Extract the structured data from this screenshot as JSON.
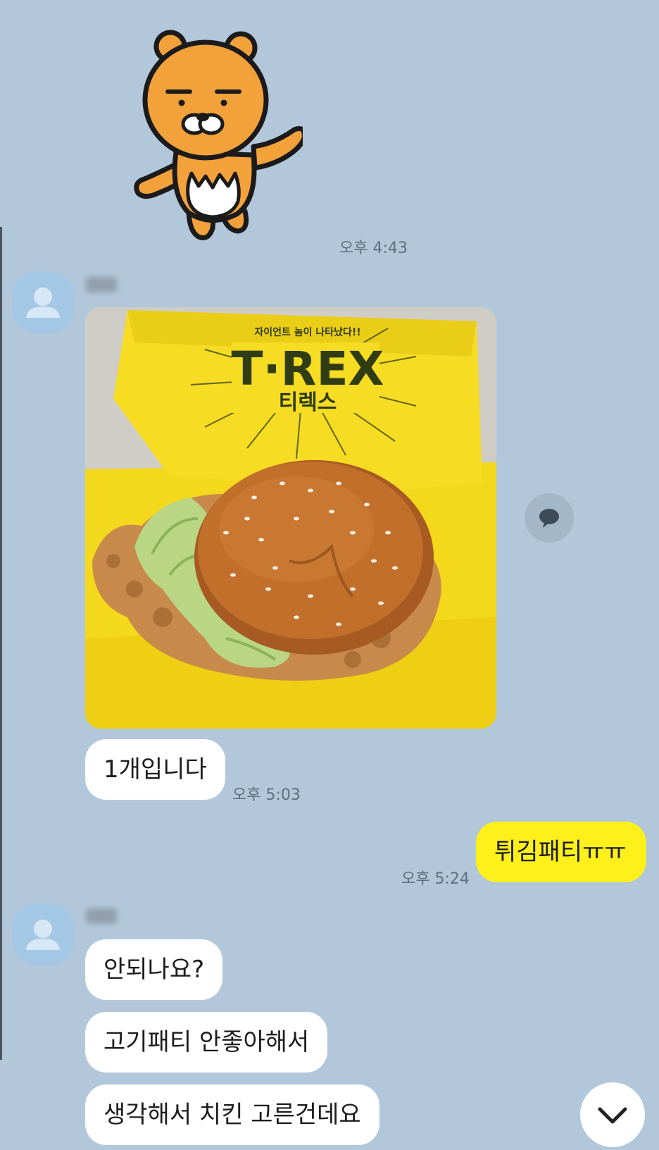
{
  "chat": {
    "messages": [
      {
        "time": "오후 4:43"
      },
      {
        "time": "오후 5:03",
        "text": "1개입니다"
      },
      {
        "time": "오후 5:24",
        "text": "튀김패티ㅠㅠ"
      },
      {
        "text": "안되나요?"
      },
      {
        "text": "고기패티 안좋아해서"
      },
      {
        "text": "생각해서 치킨 고른건데요"
      }
    ],
    "photo": {
      "wrapper_brand": "T·REX",
      "wrapper_korean": "티렉스",
      "wrapper_tagline": "자이언트 놈이 나타났다!!"
    }
  },
  "colors": {
    "background": "#b2c7da",
    "my_bubble": "#fef01b",
    "their_bubble": "#ffffff",
    "timestamp": "#5f6f7f"
  },
  "icons": {
    "sticker": "ryan-bear-sticker",
    "share": "speech-bubble-icon",
    "scroll": "chevron-down-icon",
    "avatar": "default-profile-icon"
  }
}
